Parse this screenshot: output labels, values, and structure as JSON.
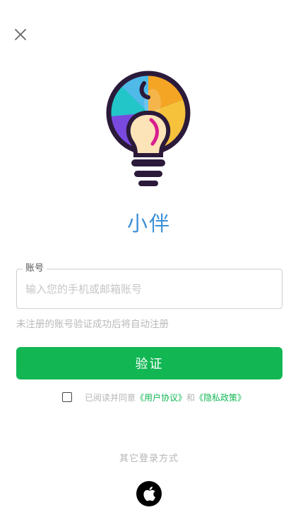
{
  "header": {
    "close_icon": "close-icon"
  },
  "logo": {
    "icon": "lightbulb-logo"
  },
  "app_name": "小伴",
  "account_field": {
    "label": "账号",
    "value": "",
    "placeholder": "输入您的手机或邮箱账号"
  },
  "hint": "未注册的账号验证成功后将自动注册",
  "verify_button": "验证",
  "agreement": {
    "checked": false,
    "prefix": "已阅读并同意",
    "user_agreement": "《用户协议》",
    "and": "和",
    "privacy_policy": "《隐私政策》"
  },
  "other_login": {
    "title": "其它登录方式",
    "apple_icon": "apple-icon"
  },
  "colors": {
    "brand_blue": "#3a8fd6",
    "accent_green": "#12b754",
    "muted_text": "#b5b5b5"
  }
}
